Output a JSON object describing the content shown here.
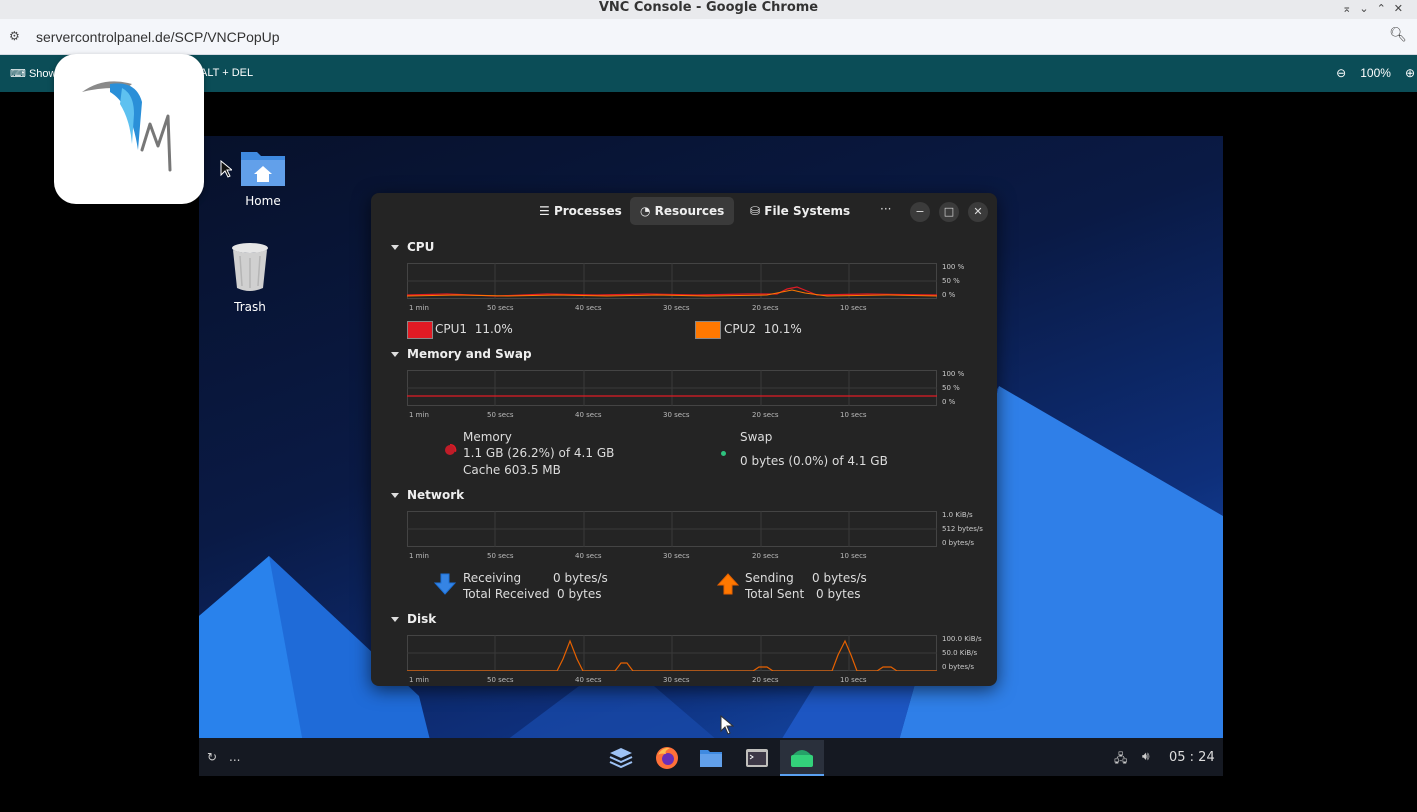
{
  "browser": {
    "window_title": "VNC Console - Google Chrome",
    "url": "servercontrolpanel.de/SCP/VNCPopUp"
  },
  "vnc_toolbar": {
    "show_label": "Show",
    "cad_label": "ALT + DEL",
    "zoom_level": "100%"
  },
  "desktop": {
    "icons": [
      {
        "label": "Home",
        "icon": "home-folder-icon"
      },
      {
        "label": "Trash",
        "icon": "trash-icon"
      }
    ]
  },
  "sysmon": {
    "tabs": [
      {
        "label": "Processes",
        "icon": "list-icon",
        "active": false
      },
      {
        "label": "Resources",
        "icon": "gauge-icon",
        "active": true
      },
      {
        "label": "File Systems",
        "icon": "drive-icon",
        "active": false
      }
    ],
    "time_ticks": [
      "1 min",
      "50 secs",
      "40 secs",
      "30 secs",
      "20 secs",
      "10 secs"
    ],
    "cpu": {
      "title": "CPU",
      "y_labels": [
        "100 %",
        "50 %",
        "0 %"
      ],
      "legend": [
        {
          "name": "CPU1",
          "value": "11.0%",
          "color": "#e01b24"
        },
        {
          "name": "CPU2",
          "value": "10.1%",
          "color": "#ff7800"
        }
      ]
    },
    "memory": {
      "title": "Memory and Swap",
      "y_labels": [
        "100 %",
        "50 %",
        "0 %"
      ],
      "mem_label": "Memory",
      "mem_value": "1.1 GB (26.2%) of 4.1 GB",
      "mem_cache": "Cache 603.5 MB",
      "swap_label": "Swap",
      "swap_value": "0 bytes (0.0%) of 4.1 GB",
      "mem_color": "#e01b24",
      "swap_color": "#2ec27e"
    },
    "network": {
      "title": "Network",
      "y_labels": [
        "1.0 KiB/s",
        "512 bytes/s",
        "0 bytes/s"
      ],
      "receiving_label": "Receiving",
      "receiving_value": "0 bytes/s",
      "total_received_label": "Total Received",
      "total_received_value": "0 bytes",
      "sending_label": "Sending",
      "sending_value": "0 bytes/s",
      "total_sent_label": "Total Sent",
      "total_sent_value": "0 bytes"
    },
    "disk": {
      "title": "Disk",
      "y_labels": [
        "100.0 KiB/s",
        "50.0 KiB/s",
        "0 bytes/s"
      ]
    }
  },
  "taskbar": {
    "left_text": "...",
    "clock": "05 : 24",
    "apps": [
      "layers-icon",
      "firefox-icon",
      "files-icon",
      "terminal-icon",
      "system-monitor-icon"
    ]
  }
}
